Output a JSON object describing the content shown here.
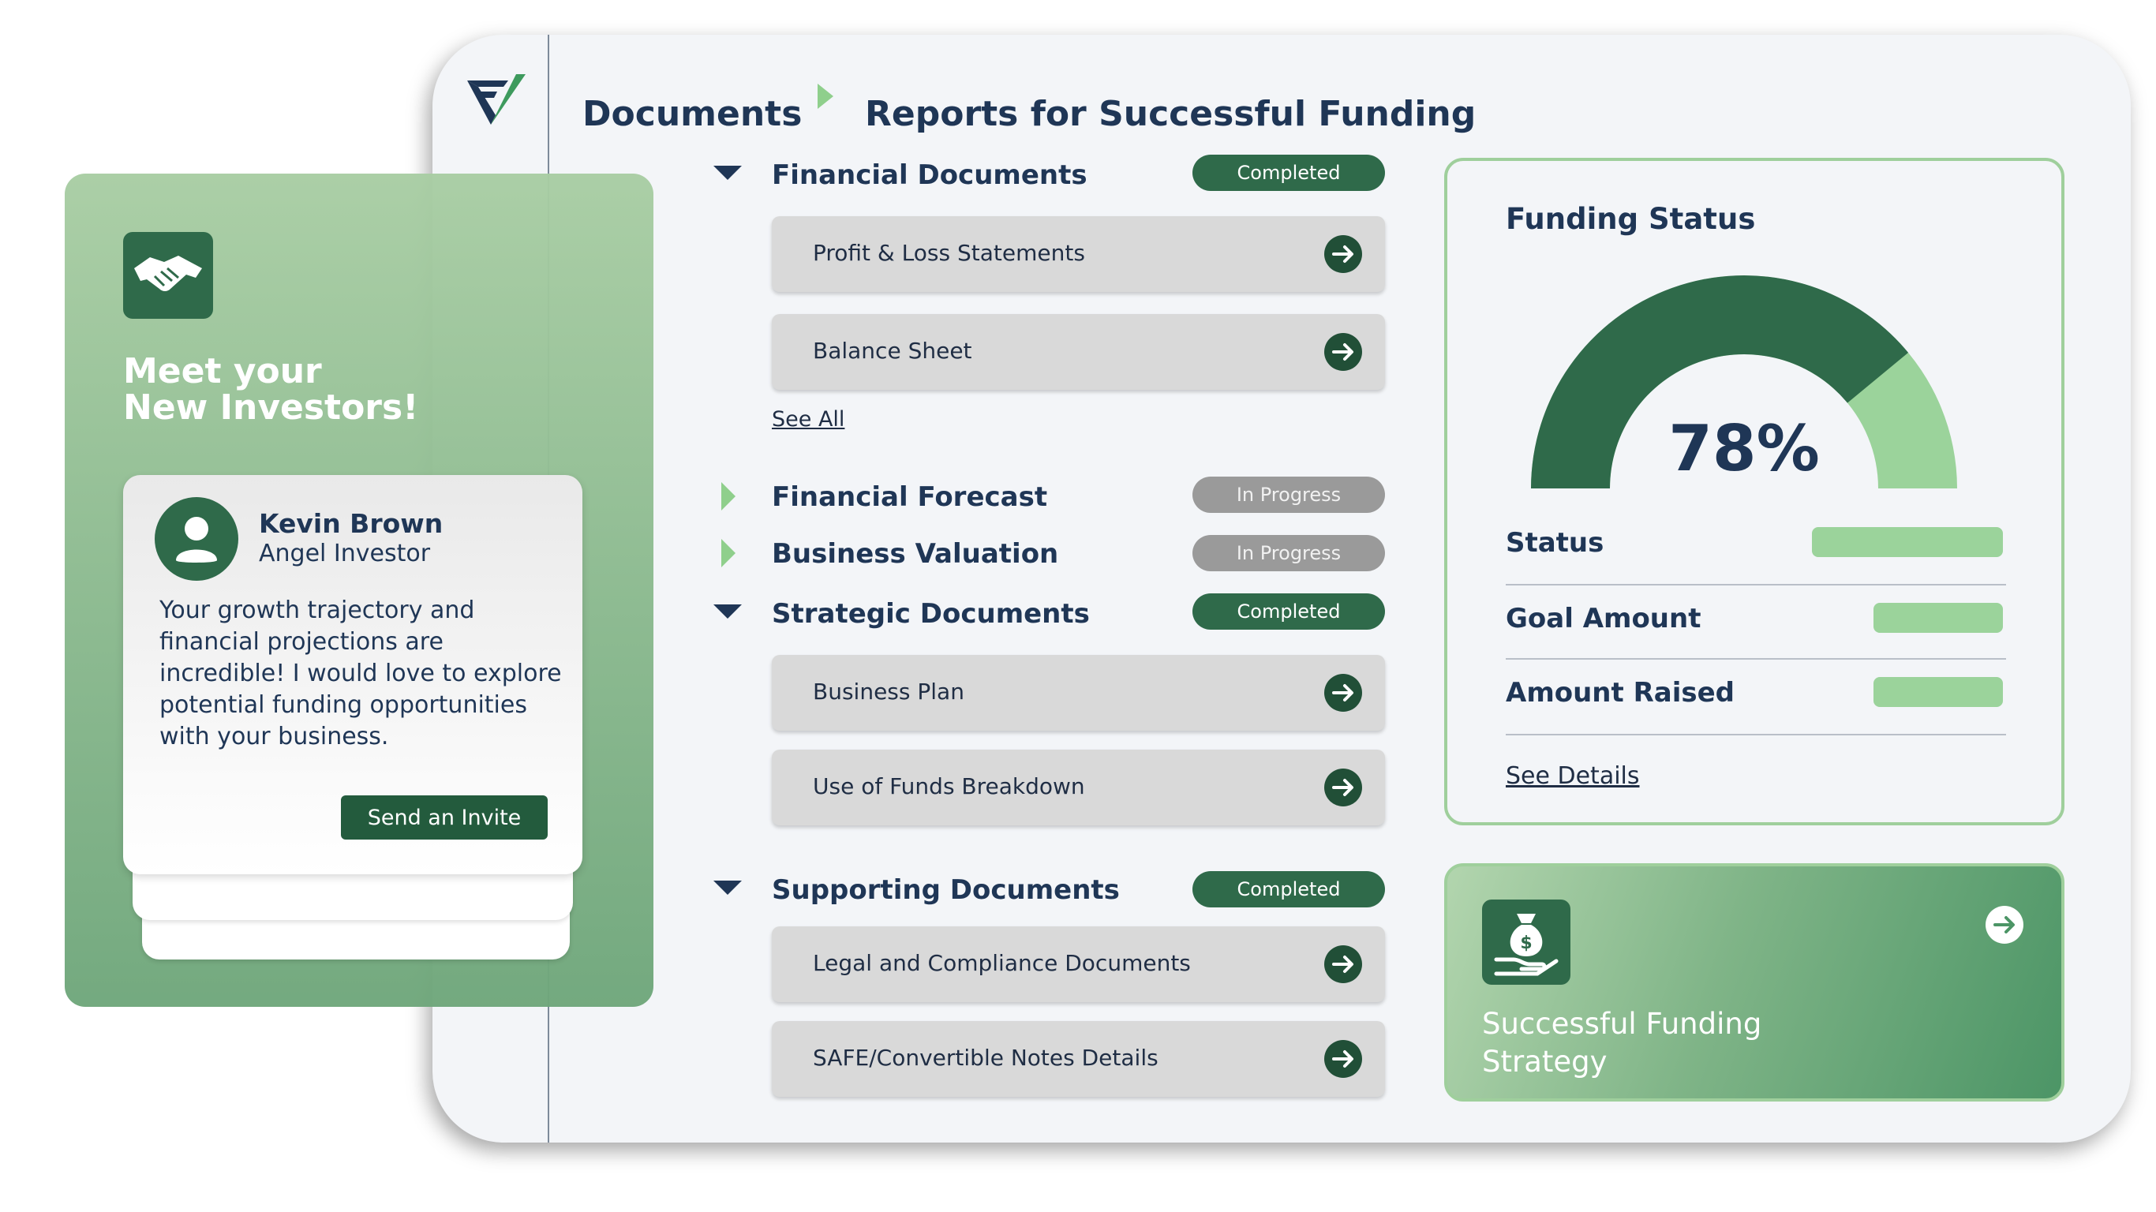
{
  "breadcrumb": {
    "root": "Documents",
    "current": "Reports for Successful Funding"
  },
  "sections": [
    {
      "title": "Financial Documents",
      "status": "Completed",
      "expanded": true,
      "items": [
        "Profit & Loss Statements",
        "Balance Sheet"
      ],
      "see_all": "See All"
    },
    {
      "title": "Financial Forecast",
      "status": "In Progress",
      "expanded": false
    },
    {
      "title": "Business Valuation",
      "status": "In Progress",
      "expanded": false
    },
    {
      "title": "Strategic Documents",
      "status": "Completed",
      "expanded": true,
      "items": [
        "Business Plan",
        "Use of Funds Breakdown"
      ]
    },
    {
      "title": "Supporting Documents",
      "status": "Completed",
      "expanded": true,
      "items": [
        "Legal and Compliance Documents",
        "SAFE/Convertible Notes Details"
      ]
    }
  ],
  "funding_status": {
    "title": "Funding Status",
    "percent_label": "78%",
    "percent": 78,
    "rows": [
      {
        "label": "Status"
      },
      {
        "label": "Goal Amount"
      },
      {
        "label": "Amount Raised"
      }
    ],
    "details_link": "See Details"
  },
  "strategy_card": {
    "title": "Successful Funding Strategy"
  },
  "investors": {
    "title_line1": "Meet your",
    "title_line2": "New Investors!",
    "name": "Kevin Brown",
    "role": "Angel Investor",
    "message": "Your growth trajectory and financial projections are incredible! I would love to explore potential funding opportunities with your business.",
    "invite_label": "Send an Invite"
  },
  "colors": {
    "brand_dark": "#2f6a4a",
    "brand_light": "#9bd39b",
    "text_navy": "#1f3656",
    "badge_progress": "#9a9a9a"
  },
  "icons": {
    "logo": "brand-logo-icon",
    "breadcrumb_separator": "caret-right-icon",
    "expanded": "caret-down-icon",
    "collapsed": "caret-right-icon",
    "row_arrow": "arrow-right-circle-icon",
    "investors": "handshake-icon",
    "avatar": "user-icon",
    "strategy": "money-bag-hand-icon"
  }
}
